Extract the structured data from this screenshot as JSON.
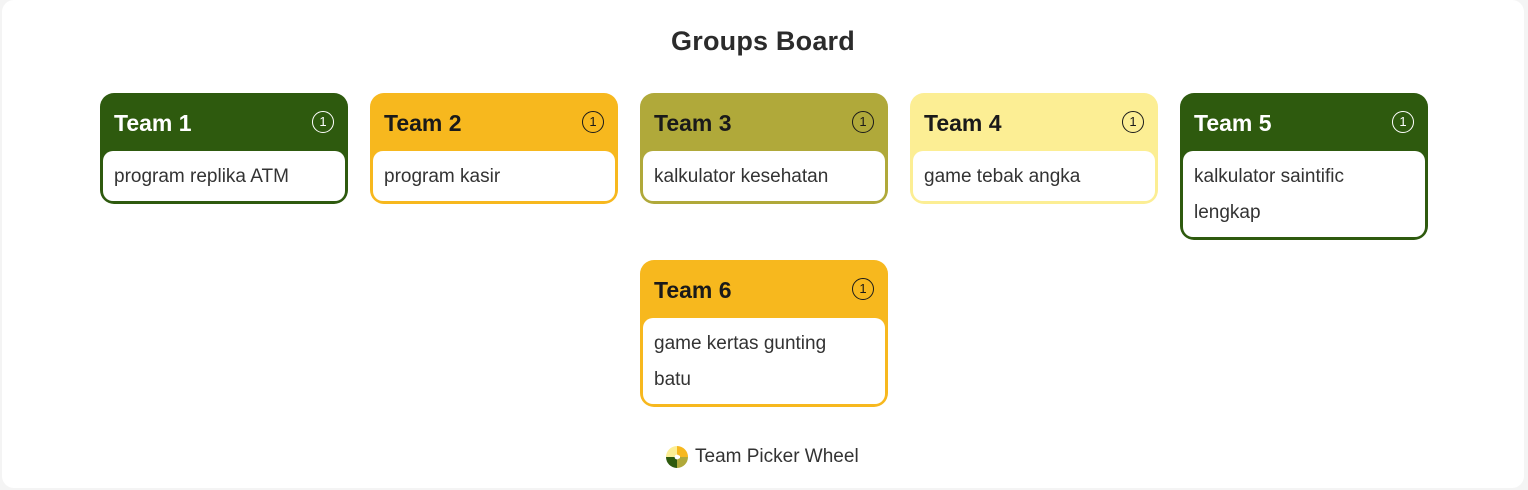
{
  "board": {
    "title": "Groups Board"
  },
  "teams": [
    {
      "name": "Team 1",
      "count": "1",
      "items": [
        "program replika ATM"
      ],
      "color": "#2e5a0e",
      "text_color": "#ffffff"
    },
    {
      "name": "Team 2",
      "count": "1",
      "items": [
        "program kasir"
      ],
      "color": "#f7b81e",
      "text_color": "#1a1a1a"
    },
    {
      "name": "Team 3",
      "count": "1",
      "items": [
        "kalkulator kesehatan"
      ],
      "color": "#b0a93a",
      "text_color": "#1a1a1a"
    },
    {
      "name": "Team 4",
      "count": "1",
      "items": [
        "game tebak angka"
      ],
      "color": "#fcee94",
      "text_color": "#1a1a1a"
    },
    {
      "name": "Team 5",
      "count": "1",
      "items": [
        "kalkulator saintific lengkap"
      ],
      "color": "#2e5a0e",
      "text_color": "#ffffff"
    },
    {
      "name": "Team 6",
      "count": "1",
      "items": [
        "game kertas gunting batu"
      ],
      "color": "#f7b81e",
      "text_color": "#1a1a1a"
    }
  ],
  "footer": {
    "label": "Team Picker Wheel",
    "icon": "team-picker-wheel-logo-icon"
  }
}
